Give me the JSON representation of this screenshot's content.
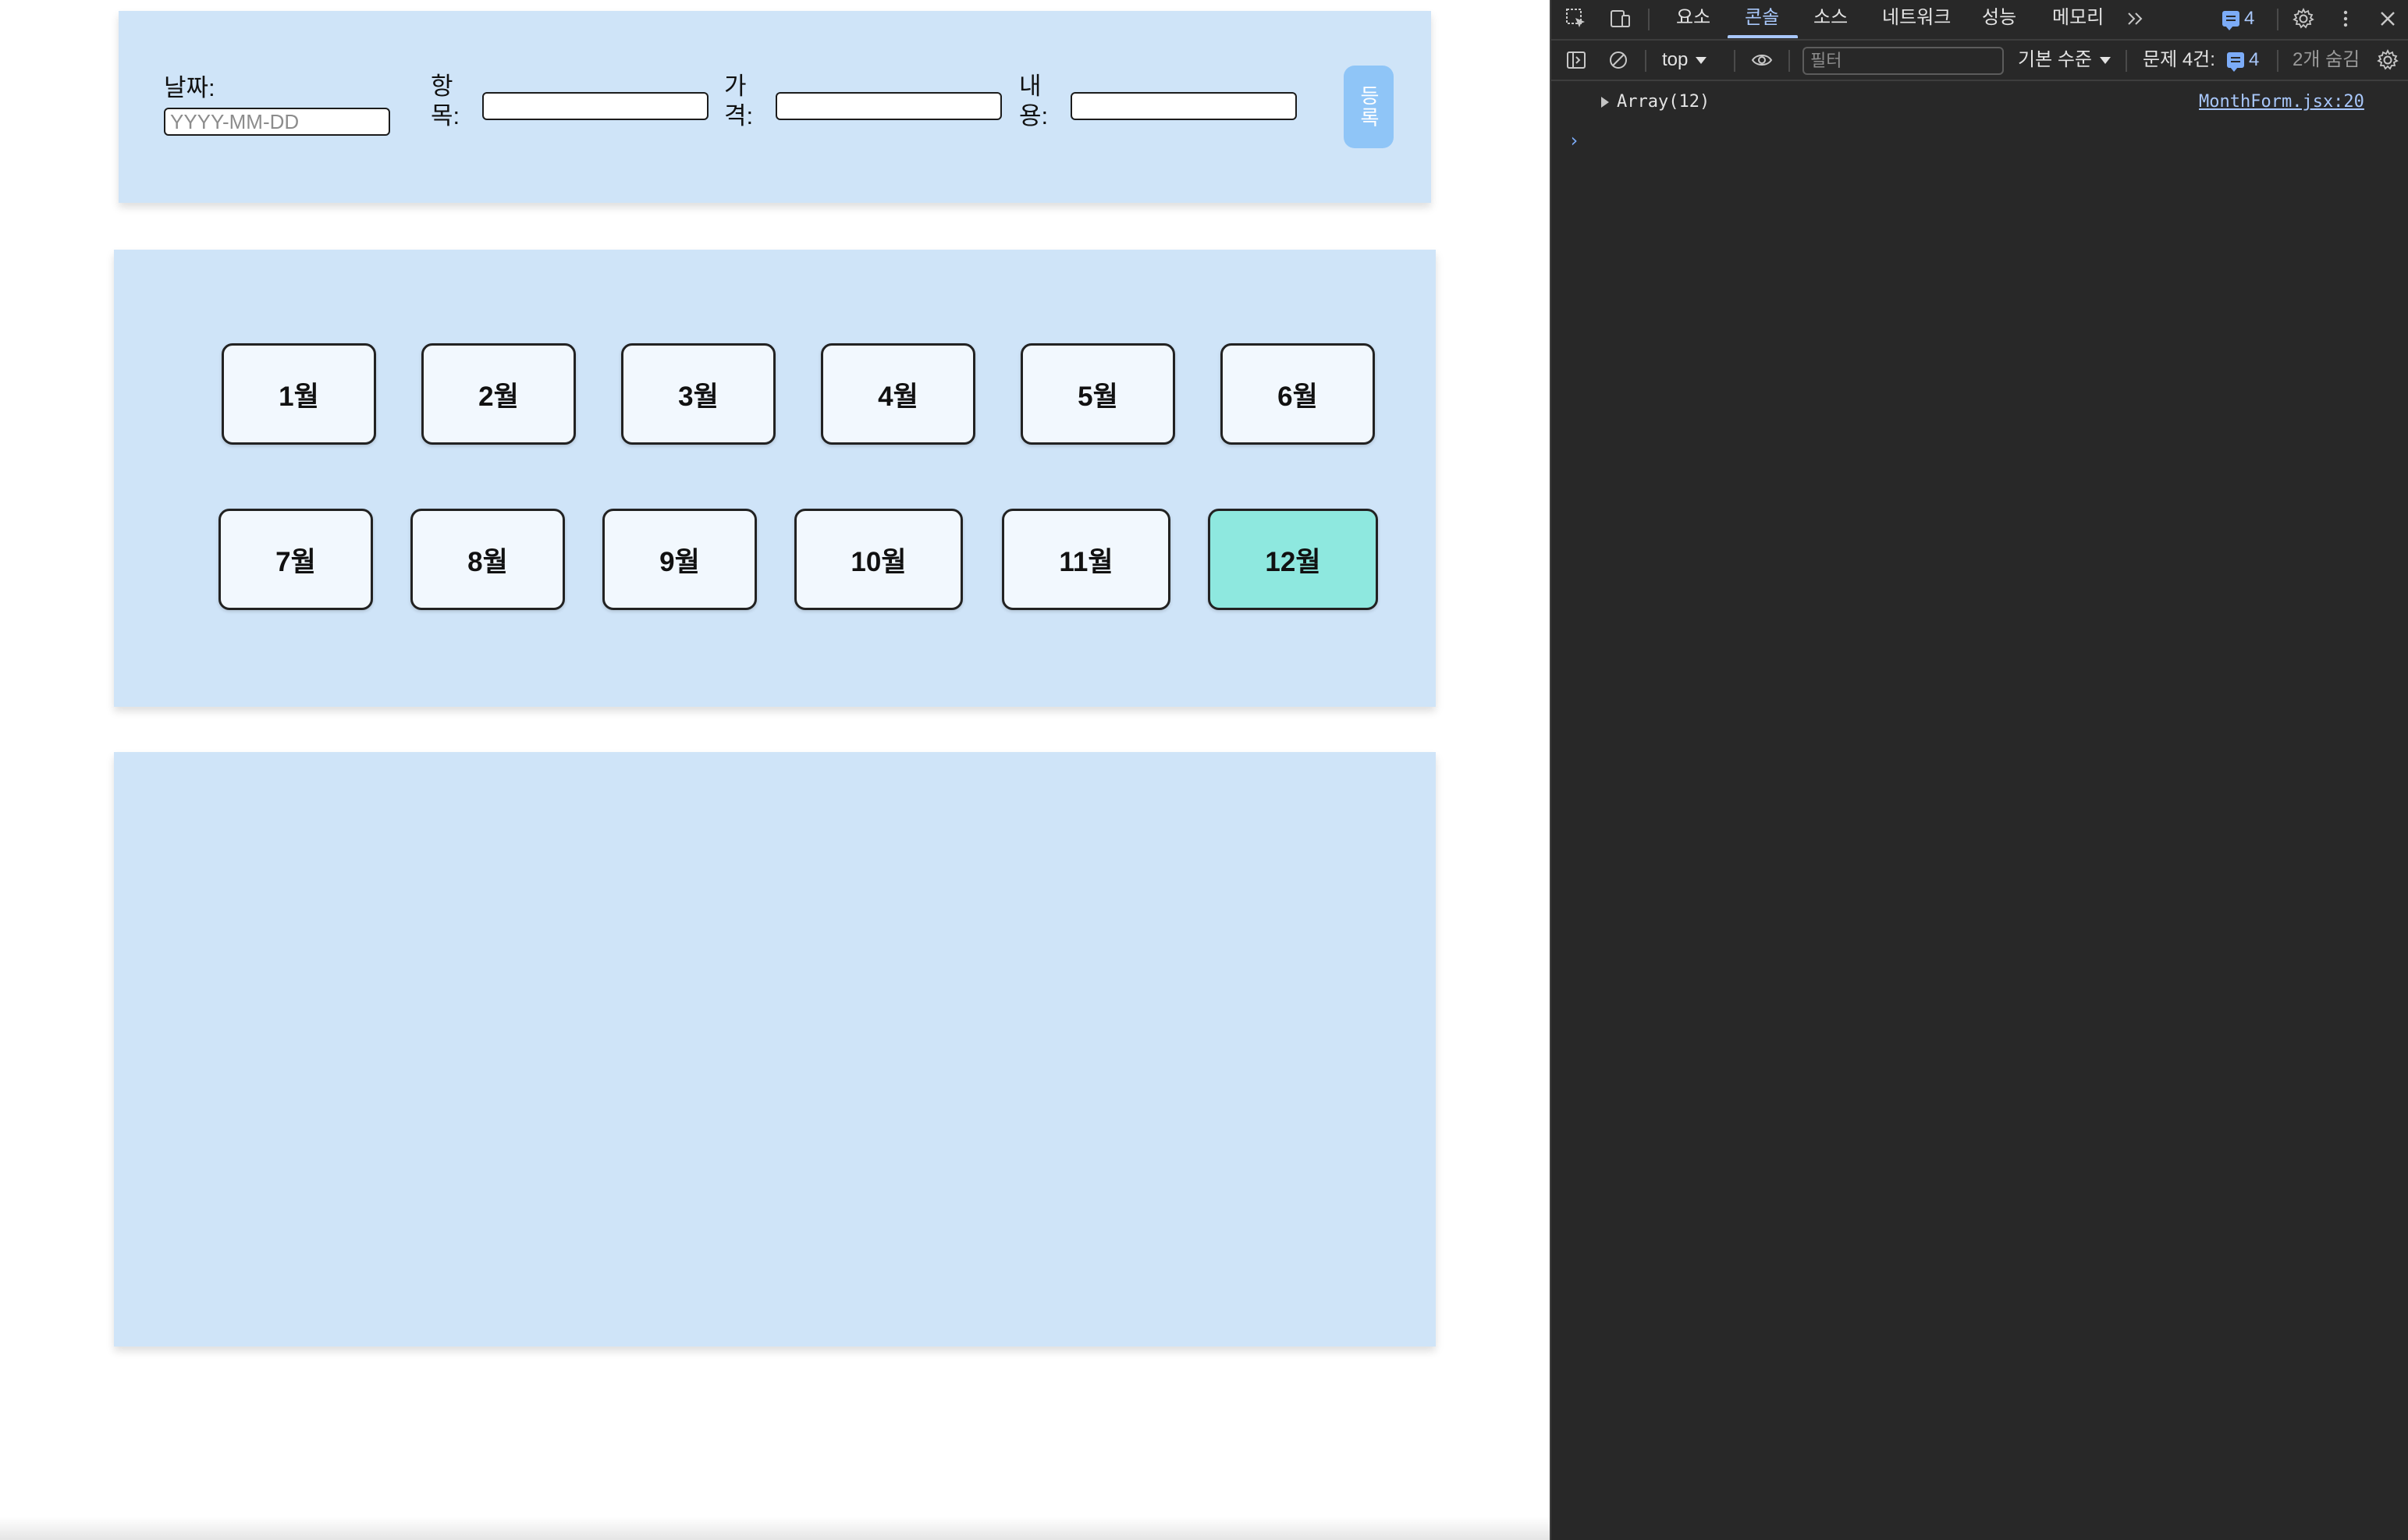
{
  "form": {
    "date_label": "날짜:",
    "date_placeholder": "YYYY-MM-DD",
    "item_label": "항\n목:",
    "price_label": "가\n격:",
    "content_label": "내\n용:",
    "submit_label": "등록"
  },
  "months": {
    "row1": [
      "1월",
      "2월",
      "3월",
      "4월",
      "5월",
      "6월"
    ],
    "row2": [
      "7월",
      "8월",
      "9월",
      "10월",
      "11월",
      "12월"
    ],
    "selected": "12월"
  },
  "devtools": {
    "tabs": [
      "요소",
      "콘솔",
      "소스",
      "네트워크",
      "성능",
      "메모리"
    ],
    "active_tab": "콘솔",
    "issues_count": "4",
    "context": "top",
    "filter_placeholder": "필터",
    "log_level": "기본 수준",
    "issues_label": "문제 4건:",
    "issues_badge_count": "4",
    "hidden_label": "2개 숨김",
    "log_entry": "Array(12)",
    "log_source": "MonthForm.jsx:20",
    "prompt": "›"
  },
  "colors": {
    "panel_bg": "#cfe4f8",
    "month_button_bg": "#f2f8fe",
    "month_selected_bg": "#8ee8df",
    "submit_bg": "#8fc5f7",
    "devtools_bg": "#282828",
    "devtools_accent": "#a8c7fa"
  }
}
